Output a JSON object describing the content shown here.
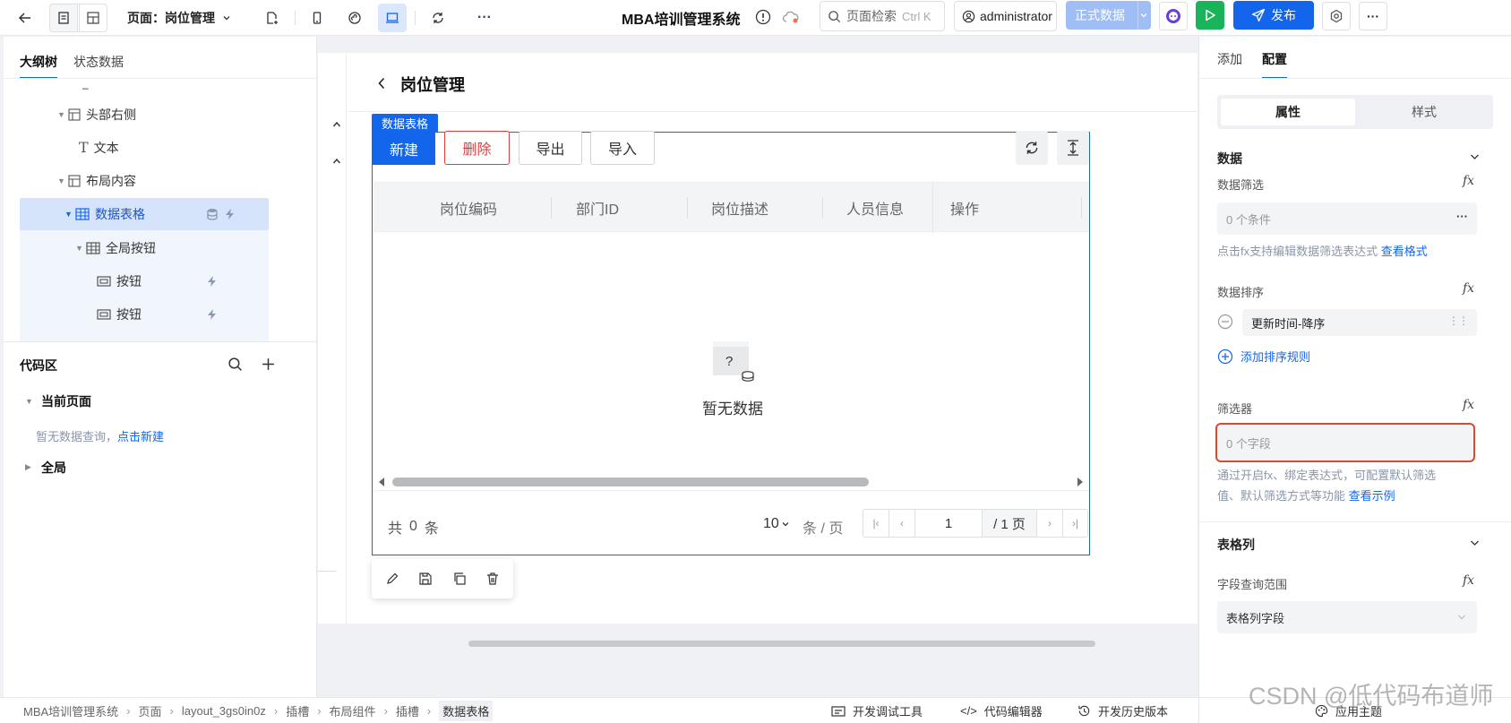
{
  "topbar": {
    "page_prefix": "页面：",
    "page_name": "岗位管理",
    "app_title": "MBA培训管理系统",
    "search_placeholder": "页面检索",
    "search_shortcut": "Ctrl K",
    "user": "administrator",
    "env": "正式数据",
    "publish": "发布"
  },
  "left": {
    "tab_outline": "大纲树",
    "tab_state": "状态数据",
    "dash": "–",
    "tree": {
      "header_right": "头部右侧",
      "text": "文本",
      "layout_content": "布局内容",
      "data_table": "数据表格",
      "global_buttons": "全局按钮",
      "button1": "按钮",
      "button2": "按钮"
    },
    "code_area": "代码区",
    "current_page": "当前页面",
    "no_query": "暂无数据查询，",
    "create_new": "点击新建",
    "global": "全局"
  },
  "canvas": {
    "page_title": "岗位管理",
    "component_tag": "数据表格",
    "btn_new": "新建",
    "btn_delete": "删除",
    "btn_export": "导出",
    "btn_import": "导入",
    "columns": [
      "岗位编码",
      "部门ID",
      "岗位描述",
      "人员信息",
      "操作"
    ],
    "empty_icon_q": "?",
    "empty_text": "暂无数据",
    "total_prefix": "共",
    "total_count": "0",
    "total_suffix": "条",
    "page_size": "10",
    "page_size_unit": "条 / 页",
    "current_page": "1",
    "page_total": "/ 1 页"
  },
  "right": {
    "tab_add": "添加",
    "tab_config": "配置",
    "seg_props": "属性",
    "seg_style": "样式",
    "section_data": "数据",
    "data_filter": "数据筛选",
    "conditions": "0 个条件",
    "filter_hint": "点击fx支持编辑数据筛选表达式",
    "filter_hint_link": "查看格式",
    "data_sort": "数据排序",
    "sort_item": "更新时间-降序",
    "add_sort": "添加排序规则",
    "filterer": "筛选器",
    "fields": "0 个字段",
    "filterer_hint1": "通过开启fx、绑定表达式，可配置默认筛选",
    "filterer_hint2": "值、默认筛选方式等功能",
    "filterer_link": "查看示例",
    "section_columns": "表格列",
    "field_scope": "字段查询范围",
    "column_fields": "表格列字段",
    "fx": "fx"
  },
  "statusbar": {
    "breadcrumb": [
      "MBA培训管理系统",
      "页面",
      "layout_3gs0in0z",
      "插槽",
      "布局组件",
      "插槽",
      "数据表格"
    ],
    "devtools": "开发调试工具",
    "code_editor": "代码编辑器",
    "history": "开发历史版本",
    "theme": "应用主题"
  },
  "watermark": "CSDN @低代码布道师",
  "colors": {
    "primary": "#1366ec",
    "danger": "#e03e3e",
    "env_button": "#9fbef5",
    "play": "#19b35a"
  }
}
